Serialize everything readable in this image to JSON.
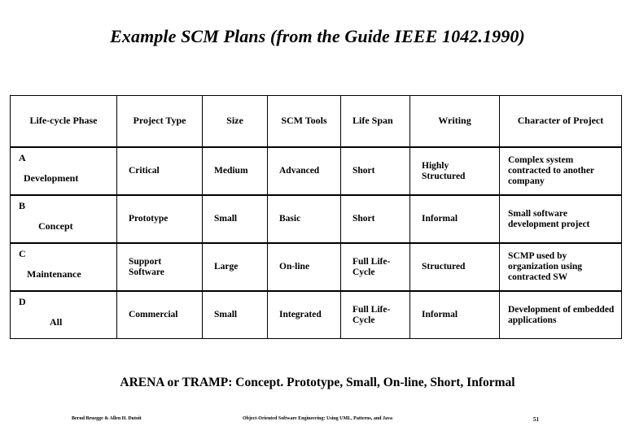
{
  "slide": {
    "title": "Example SCM Plans (from the Guide IEEE 1042.1990)",
    "caption": "ARENA or TRAMP: Concept. Prototype, Small, On-line, Short, Informal"
  },
  "table": {
    "headers": [
      "Life-cycle Phase",
      "Project Type",
      "Size",
      "SCM Tools",
      "Life Span",
      "Writing",
      "Character of Project"
    ],
    "rows": [
      {
        "letter": "A",
        "phase": "Development",
        "project_type": "Critical",
        "size": "Medium",
        "scm_tools": "Advanced",
        "life_span": "Short",
        "writing": "Highly Structured",
        "character": "Complex system contracted to another company"
      },
      {
        "letter": "B",
        "phase": "Concept",
        "project_type": "Prototype",
        "size": "Small",
        "scm_tools": "Basic",
        "life_span": "Short",
        "writing": "Informal",
        "character": "Small software development project"
      },
      {
        "letter": "C",
        "phase": "Maintenance",
        "project_type": "Support Software",
        "size": "Large",
        "scm_tools": "On-line",
        "life_span": "Full Life-Cycle",
        "writing": "Structured",
        "character": "SCMP used by organization using contracted SW"
      },
      {
        "letter": "D",
        "phase": "All",
        "project_type": "Commercial",
        "size": "Small",
        "scm_tools": "Integrated",
        "life_span": "Full Life-Cycle",
        "writing": "Informal",
        "character": "Development of embedded applications"
      }
    ]
  },
  "footer": {
    "authors": "Bernd Bruegge & Allen H. Dutoit",
    "book": "Object-Oriented Software Engineering: Using UML, Patterns, and Java",
    "page": "51"
  }
}
